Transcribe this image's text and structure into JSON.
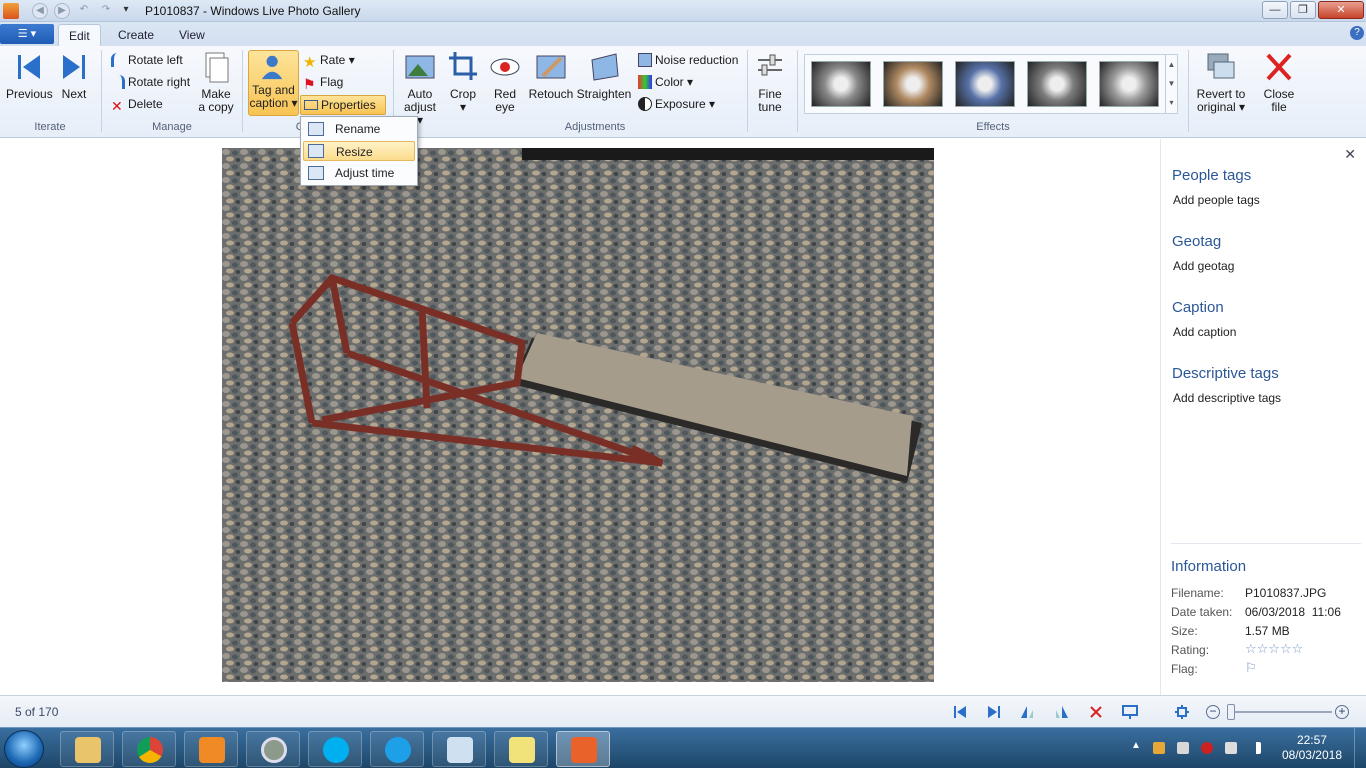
{
  "window": {
    "title": "P1010837 - Windows Live Photo Gallery"
  },
  "tabs": [
    {
      "label": "Edit"
    },
    {
      "label": "Create"
    },
    {
      "label": "View"
    }
  ],
  "ribbon": {
    "iterate": {
      "label": "Iterate",
      "previous": "Previous",
      "next": "Next"
    },
    "manage": {
      "label": "Manage",
      "rotate_left": "Rotate left",
      "rotate_right": "Rotate right",
      "delete": "Delete",
      "make_copy_1": "Make",
      "make_copy_2": "a copy"
    },
    "organize": {
      "label": "O",
      "tag_1": "Tag and",
      "tag_2": "caption",
      "rate": "Rate",
      "flag": "Flag",
      "properties": "Properties"
    },
    "adjustments": {
      "label": "Adjustments",
      "auto_1": "Auto",
      "auto_2": "adjust",
      "crop": "Crop",
      "red_1": "Red",
      "red_2": "eye",
      "retouch": "Retouch",
      "straighten": "Straighten",
      "noise": "Noise reduction",
      "color": "Color",
      "exposure": "Exposure",
      "fine_1": "Fine",
      "fine_2": "tune"
    },
    "effects": {
      "label": "Effects",
      "swatches": [
        "#8a8a8a",
        "#b08a62",
        "#5872a8",
        "#7d7d7d",
        "#9a9a9a"
      ]
    },
    "revert_1": "Revert to",
    "revert_2": "original",
    "close_1": "Close",
    "close_2": "file"
  },
  "properties_menu": {
    "items": [
      {
        "label": "Rename"
      },
      {
        "label": "Resize"
      },
      {
        "label": "Adjust time"
      }
    ]
  },
  "pane": {
    "people": {
      "heading": "People tags",
      "action": "Add people tags"
    },
    "geotag": {
      "heading": "Geotag",
      "action": "Add geotag"
    },
    "caption": {
      "heading": "Caption",
      "action": "Add caption"
    },
    "descriptive": {
      "heading": "Descriptive tags",
      "action": "Add descriptive tags"
    },
    "info": {
      "heading": "Information",
      "filename_k": "Filename:",
      "filename_v": "P1010837.JPG",
      "date_k": "Date taken:",
      "date_v": "06/03/2018  11:06",
      "size_k": "Size:",
      "size_v": "1.57 MB",
      "rating_k": "Rating:",
      "rating_v": "☆☆☆☆☆",
      "flag_k": "Flag:",
      "flag_v": "⚐"
    }
  },
  "status": {
    "counter": "5 of 170",
    "zoom_level": 0.0
  },
  "taskbar": {
    "time": "22:57",
    "date": "08/03/2018"
  },
  "colors": {
    "accent": "#2b5797",
    "highlight": "#fbdc8c"
  }
}
